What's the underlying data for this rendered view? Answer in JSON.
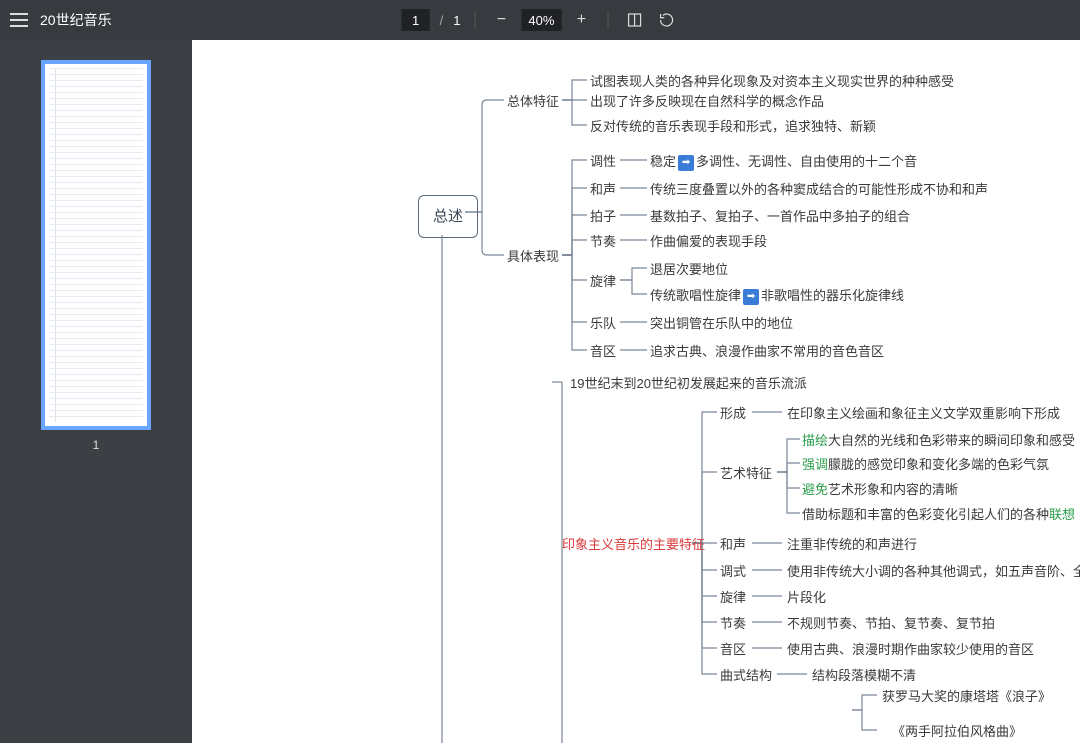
{
  "toolbar": {
    "title": "20世纪音乐",
    "page_current": "1",
    "page_total": "1",
    "zoom": "40%"
  },
  "sidebar": {
    "thumb_num": "1"
  },
  "mindmap": {
    "root": "总述",
    "b1": {
      "label": "总体特征",
      "items": [
        "试图表现人类的各种异化现象及对资本主义现实世界的种种感受",
        "出现了许多反映现在自然科学的概念作品",
        "反对传统的音乐表现手段和形式，追求独特、新颖"
      ]
    },
    "b2": {
      "label": "具体表现",
      "rows": [
        {
          "k": "调性",
          "pre": "稳定",
          "arrow": "➡",
          "post": "多调性、无调性、自由使用的十二个音"
        },
        {
          "k": "和声",
          "v": "传统三度叠置以外的各种窦成结合的可能性形成不协和和声"
        },
        {
          "k": "拍子",
          "v": "基数拍子、复拍子、一首作品中多拍子的组合"
        },
        {
          "k": "节奏",
          "v": "作曲偏爱的表现手段"
        },
        {
          "k": "旋律",
          "sub": [
            "退居次要地位",
            {
              "pre": "传统歌唱性旋律",
              "arrow": "➡",
              "post": "非歌唱性的器乐化旋律线"
            }
          ]
        },
        {
          "k": "乐队",
          "v": "突出铜管在乐队中的地位"
        },
        {
          "k": "音区",
          "v": "追求古典、浪漫作曲家不常用的音色音区"
        }
      ]
    },
    "section2": {
      "intro": "19世纪末到20世纪初发展起来的音乐流派",
      "main": "印象主义音乐的主要特征",
      "rows": [
        {
          "k": "形成",
          "v": "在印象主义绘画和象征主义文学双重影响下形成"
        },
        {
          "k": "艺术特征",
          "sub": [
            {
              "g": "描绘",
              "t": "大自然的光线和色彩带来的瞬间印象和感受"
            },
            {
              "g": "强调",
              "t": "朦胧的感觉印象和变化多端的色彩气氛"
            },
            {
              "g": "避免",
              "t": "艺术形象和内容的清晰"
            },
            {
              "t": "借助标题和丰富的色彩变化引起人们的各种",
              "g2": "联想"
            }
          ]
        },
        {
          "k": "和声",
          "v": "注重非传统的和声进行"
        },
        {
          "k": "调式",
          "v": "使用非传统大小调的各种其他调式，如五声音阶、全音阶"
        },
        {
          "k": "旋律",
          "v": "片段化"
        },
        {
          "k": "节奏",
          "v": "不规则节奏、节拍、复节奏、复节拍"
        },
        {
          "k": "音区",
          "v": "使用古典、浪漫时期作曲家较少使用的音区"
        },
        {
          "k": "曲式结构",
          "v": "结构段落模糊不清"
        }
      ],
      "works": [
        "获罗马大奖的康塔塔《浪子》",
        "《两手阿拉伯风格曲》"
      ]
    }
  }
}
